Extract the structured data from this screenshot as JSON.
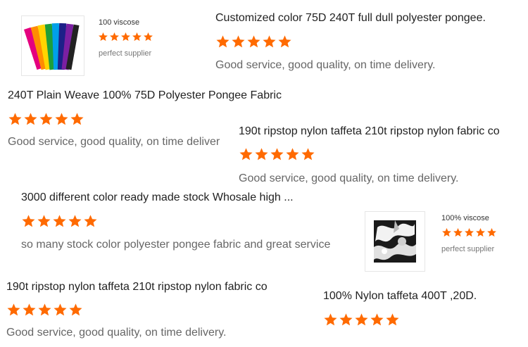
{
  "accent_color": "#ff6a00",
  "review_cards": [
    {
      "thumb_icon": "fabric-swatch-image",
      "product": "100 viscose",
      "rating_stars": 5,
      "tag": "perfect supplier"
    },
    {
      "title": "Customized color 75D 240T full dull polyester pongee.",
      "rating_stars": 5,
      "comment": "Good service, good quality, on time delivery."
    },
    {
      "title": "240T Plain Weave 100% 75D Polyester Pongee Fabric",
      "rating_stars": 5,
      "comment": "Good service, good quality, on time deliver"
    },
    {
      "title": "190t ripstop nylon taffeta 210t ripstop nylon fabric co",
      "rating_stars": 5,
      "comment": "Good service, good quality, on time delivery."
    },
    {
      "title": "3000 different color ready made stock Whosale high ...",
      "rating_stars": 5,
      "comment": "so many stock color polyester pongee fabric and great service"
    },
    {
      "thumb_icon": "printed-fabric-image",
      "product": "100% viscose",
      "rating_stars": 5,
      "tag": "perfect supplier"
    },
    {
      "title": "190t ripstop nylon taffeta 210t ripstop nylon fabric co",
      "rating_stars": 5,
      "comment": "Good service, good quality, on time delivery."
    },
    {
      "title": "100% Nylon taffeta 400T ,20D.",
      "rating_stars": 5,
      "comment": ""
    }
  ]
}
